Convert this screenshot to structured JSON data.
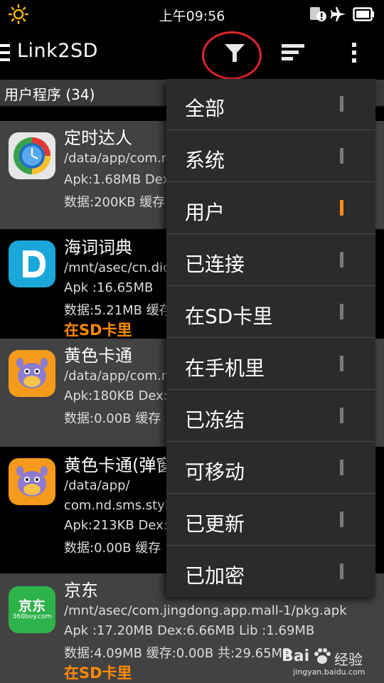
{
  "status_bar": {
    "time": "上午09:56",
    "icons": [
      "brightness-icon",
      "sim-alert-icon",
      "airplane-icon",
      "battery-icon"
    ]
  },
  "action_bar": {
    "title": "Link2SD",
    "buttons": [
      "filter-icon",
      "sort-icon",
      "overflow-menu-icon"
    ]
  },
  "section": {
    "title": "用户程序 (34)"
  },
  "apps": [
    {
      "name": "定时达人",
      "path": "/data/app/com.n",
      "line3": "Apk:1.68MB  Dex",
      "line4": "数据:200KB  缓存",
      "sd": ""
    },
    {
      "name": "海词词典",
      "path": "/mnt/asec/cn.dic",
      "line3": "Apk   :16.65MB",
      "line4": "数据:5.21MB   缓存",
      "sd": "在SD卡里"
    },
    {
      "name": "黄色卡通",
      "path": "/data/app/com.n",
      "line3": "Apk:180KB  Dex:",
      "line4": "数据:0.00B   缓存",
      "sd": ""
    },
    {
      "name": "黄色卡通(弹窗",
      "path": "/data/app/",
      "path2": "com.nd.sms.style",
      "line3": "Apk:213KB  Dex:",
      "line4": "数据:0.00B   缓存",
      "sd": ""
    },
    {
      "name": "京东",
      "path": "/mnt/asec/com.jingdong.app.mall-1/pkg.apk",
      "line3": "Apk   :17.20MB  Dex:6.66MB  Lib   :1.69MB",
      "line4": "数据:4.09MB  缓存:0.00B  共:29.65MB",
      "sd": "在SD卡里",
      "icon_text": "京东",
      "icon_subtext": "360buy.com"
    }
  ],
  "filter_menu": {
    "items": [
      {
        "label": "全部",
        "selected": false
      },
      {
        "label": "系统",
        "selected": false
      },
      {
        "label": "用户",
        "selected": true
      },
      {
        "label": "已连接",
        "selected": false
      },
      {
        "label": "在SD卡里",
        "selected": false
      },
      {
        "label": "在手机里",
        "selected": false
      },
      {
        "label": "已冻结",
        "selected": false
      },
      {
        "label": "可移动",
        "selected": false
      },
      {
        "label": "已更新",
        "selected": false
      },
      {
        "label": "已加密",
        "selected": false
      }
    ],
    "selected_color": "#ff8c1a"
  },
  "watermark": {
    "brand": "Bai",
    "brand2": "经验",
    "url": "jingyan.baidu.com"
  }
}
